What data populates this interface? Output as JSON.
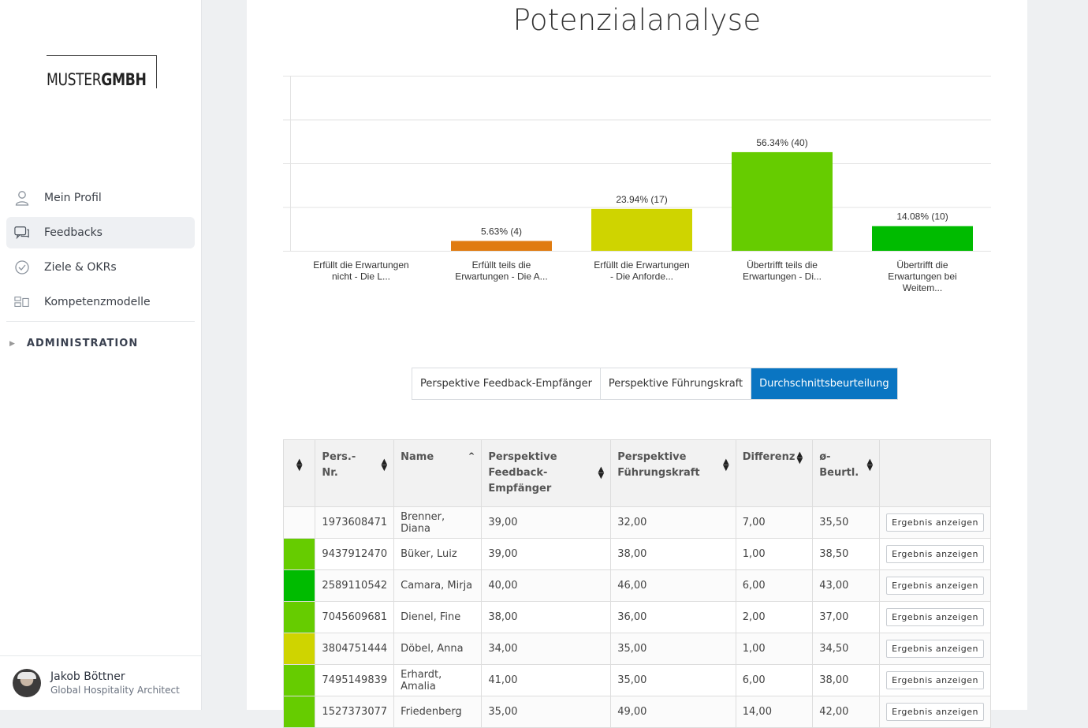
{
  "sidebar": {
    "logo": {
      "part1": "MUSTER",
      "part2": "GMBH"
    },
    "items": [
      {
        "label": "Mein Profil",
        "icon": "user-icon"
      },
      {
        "label": "Feedbacks",
        "icon": "chat-icon"
      },
      {
        "label": "Ziele & OKRs",
        "icon": "check-circle-icon"
      },
      {
        "label": "Kompetenzmodelle",
        "icon": "modules-icon"
      }
    ],
    "admin_label": "ADMINISTRATION",
    "user": {
      "name": "Jakob Böttner",
      "role": "Global Hospitality Architect"
    }
  },
  "page": {
    "title": "Potenzialanalyse"
  },
  "chart_data": {
    "type": "bar",
    "categories": [
      [
        "Erfüllt die Erwartungen",
        "nicht - Die L..."
      ],
      [
        "Erfüllt teils die",
        "Erwartungen - Die A..."
      ],
      [
        "Erfüllt die Erwartungen",
        "- Die Anforde..."
      ],
      [
        "Übertrifft teils die",
        "Erwartungen - Di..."
      ],
      [
        "Übertrifft die",
        "Erwartungen bei",
        "Weitem..."
      ]
    ],
    "values": [
      0,
      5.63,
      23.94,
      56.34,
      14.08
    ],
    "counts": [
      0,
      4,
      17,
      40,
      10
    ],
    "labels": [
      "",
      "5.63% (4)",
      "23.94% (17)",
      "56.34% (40)",
      "14.08% (10)"
    ],
    "colors": [
      "#cccccc",
      "#e07b10",
      "#cfd400",
      "#66cc00",
      "#00bb00"
    ],
    "ylim": [
      0,
      100
    ],
    "grid": true
  },
  "tabs": [
    {
      "label": "Perspektive Feedback-Empfänger",
      "active": false
    },
    {
      "label": "Perspektive Führungskraft",
      "active": false
    },
    {
      "label": "Durchschnittsbeurteilung",
      "active": true
    }
  ],
  "table": {
    "headers": [
      "",
      "Pers.-Nr.",
      "Name",
      "Perspektive Feedback-Empfänger",
      "Perspektive Führungskraft",
      "Differenz",
      "ø-Beurtl.",
      ""
    ],
    "button_label": "Ergebnis anzeigen",
    "rows": [
      {
        "color": "",
        "nr": "1973608471",
        "name": "Brenner, Diana",
        "fe": "39,00",
        "fk": "32,00",
        "diff": "7,00",
        "avg": "35,50"
      },
      {
        "color": "#66cc00",
        "nr": "9437912470",
        "name": "Büker, Luiz",
        "fe": "39,00",
        "fk": "38,00",
        "diff": "1,00",
        "avg": "38,50"
      },
      {
        "color": "#00bb00",
        "nr": "2589110542",
        "name": "Camara, Mirja",
        "fe": "40,00",
        "fk": "46,00",
        "diff": "6,00",
        "avg": "43,00"
      },
      {
        "color": "#66cc00",
        "nr": "7045609681",
        "name": "Dienel, Fine",
        "fe": "38,00",
        "fk": "36,00",
        "diff": "2,00",
        "avg": "37,00"
      },
      {
        "color": "#cfd400",
        "nr": "3804751444",
        "name": "Döbel, Anna",
        "fe": "34,00",
        "fk": "35,00",
        "diff": "1,00",
        "avg": "34,50"
      },
      {
        "color": "#66cc00",
        "nr": "7495149839",
        "name": "Erhardt, Amalia",
        "fe": "41,00",
        "fk": "35,00",
        "diff": "6,00",
        "avg": "38,00"
      },
      {
        "color": "#66cc00",
        "nr": "1527373077",
        "name": "Friedenberg",
        "fe": "35,00",
        "fk": "49,00",
        "diff": "14,00",
        "avg": "42,00"
      }
    ]
  }
}
